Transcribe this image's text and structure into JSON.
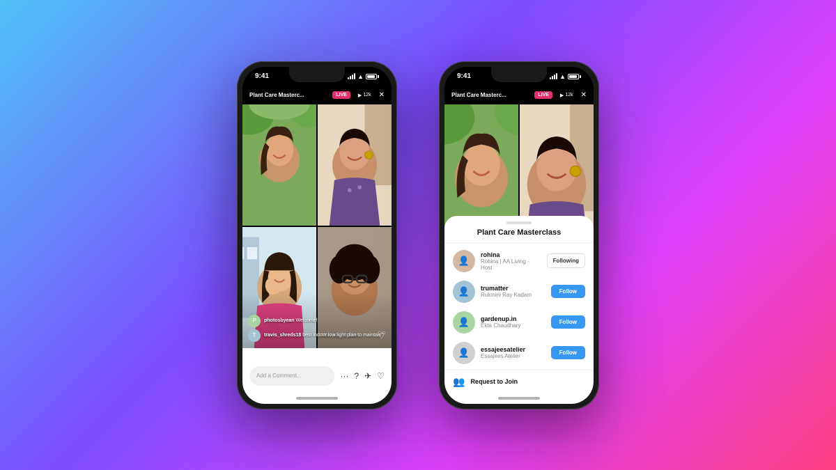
{
  "background": "linear-gradient(135deg, #4fc3f7 0%, #7c4dff 40%, #e040fb 70%, #ff4081 100%)",
  "phone1": {
    "status_time": "9:41",
    "live_title": "Plant Care Masterc...",
    "live_badge": "LIVE",
    "viewers": "12k",
    "comment_placeholder": "Add a Comment...",
    "chat": [
      {
        "username": "photosbyean",
        "message": "Welcome!"
      },
      {
        "username": "travis_shreds18",
        "message": "best indoor low light plan to maintain?"
      }
    ]
  },
  "phone2": {
    "status_time": "9:41",
    "live_title": "Plant Care Masterc...",
    "live_badge": "LIVE",
    "viewers": "12k",
    "modal": {
      "title": "Plant Care Masterclass",
      "users": [
        {
          "username": "rohina",
          "subtext": "Rohina | AA Living · Host",
          "button": "Following",
          "style": "following"
        },
        {
          "username": "trumatter",
          "subtext": "Rukmini Ray Kadam",
          "button": "Follow",
          "style": "follow"
        },
        {
          "username": "gardenup.in",
          "subtext": "Ekta Chaudhary",
          "button": "Follow",
          "style": "follow"
        },
        {
          "username": "essajeesatelier",
          "subtext": "Essajees Atelier",
          "button": "Follow",
          "style": "follow"
        }
      ],
      "request_join": "Request to Join"
    }
  }
}
